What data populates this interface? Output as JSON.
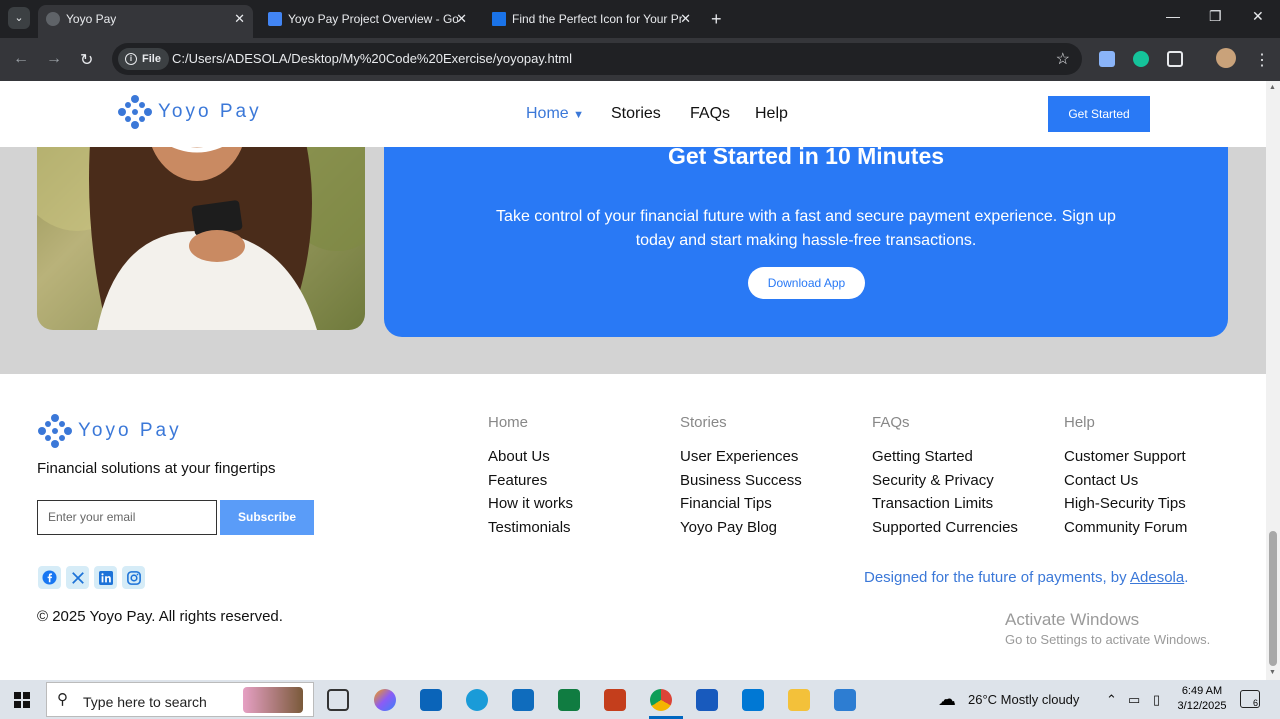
{
  "browser": {
    "tabs": [
      {
        "title": "Yoyo Pay",
        "active": true
      },
      {
        "title": "Yoyo Pay Project Overview - Go",
        "active": false
      },
      {
        "title": "Find the Perfect Icon for Your Pr",
        "active": false
      }
    ],
    "address_chip": "File",
    "url": "C:/Users/ADESOLA/Desktop/My%20Code%20Exercise/yoyopay.html"
  },
  "navbar": {
    "logo_text": "Yoyo Pay",
    "links": [
      "Home",
      "Stories",
      "FAQs",
      "Help"
    ],
    "cta": "Get Started"
  },
  "hero": {
    "title": "Get Started in 10 Minutes",
    "text": "Take control of your financial future with a fast and secure payment experience. Sign up today and start making hassle-free transactions.",
    "button": "Download App"
  },
  "footer": {
    "logo_text": "Yoyo Pay",
    "tagline": "Financial solutions at your fingertips",
    "email_placeholder": "Enter your email",
    "subscribe": "Subscribe",
    "social": [
      "facebook-icon",
      "x-icon",
      "linkedin-icon",
      "instagram-icon"
    ],
    "copyright": "© 2025 Yoyo Pay. All rights reserved.",
    "columns": [
      {
        "heading": "Home",
        "links": [
          "About Us",
          "Features",
          "How it works",
          "Testimonials"
        ]
      },
      {
        "heading": "Stories",
        "links": [
          "User Experiences",
          "Business Success",
          "Financial Tips",
          "Yoyo Pay Blog"
        ]
      },
      {
        "heading": "FAQs",
        "links": [
          "Getting Started",
          "Security & Privacy",
          "Transaction Limits",
          "Supported Currencies"
        ]
      },
      {
        "heading": "Help",
        "links": [
          "Customer Support",
          "Contact Us",
          "High-Security Tips",
          "Community Forum"
        ]
      }
    ],
    "designed_prefix": "Designed for the future of payments, by ",
    "designed_author": "Adesola",
    "designed_suffix": "."
  },
  "watermark": {
    "line1": "Activate Windows",
    "line2": "Go to Settings to activate Windows."
  },
  "taskbar": {
    "search_placeholder": "Type here to search",
    "weather": "26°C  Mostly cloudy",
    "time": "6:49 AM",
    "date": "3/12/2025",
    "notifications": "6"
  },
  "colors": {
    "accent": "#2979f5",
    "logo": "#3b78d8",
    "hero_bg": "#d3d3d3"
  }
}
